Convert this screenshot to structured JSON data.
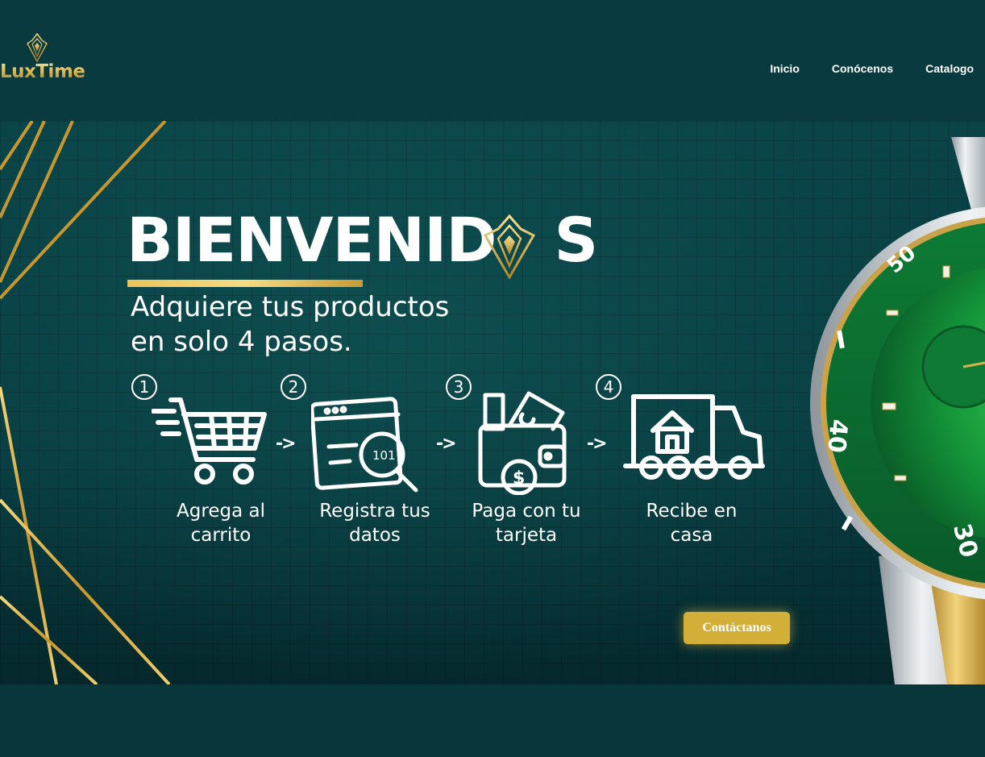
{
  "brand": {
    "name": "LuxTime",
    "accent_color": "#d4af37"
  },
  "nav": {
    "items": [
      "Inicio",
      "Conócenos",
      "Catalogo"
    ]
  },
  "hero": {
    "title_main": "BIENVENID",
    "title_tail": "S",
    "subtitle_line1": "Adquiere tus productos",
    "subtitle_line2": "en solo 4 pasos.",
    "steps": [
      {
        "number": "1",
        "icon": "shopping-cart-icon",
        "label_line1": "Agrega al",
        "label_line2": "carrito"
      },
      {
        "number": "2",
        "icon": "browser-search-icon",
        "label_line1": "Registra tus",
        "label_line2": "datos"
      },
      {
        "number": "3",
        "icon": "wallet-icon",
        "label_line1": "Paga con tu",
        "label_line2": "tarjeta"
      },
      {
        "number": "4",
        "icon": "delivery-truck-icon",
        "label_line1": "Recibe en",
        "label_line2": "casa"
      }
    ],
    "arrow": "->",
    "cta_label": "Contáctanos"
  }
}
